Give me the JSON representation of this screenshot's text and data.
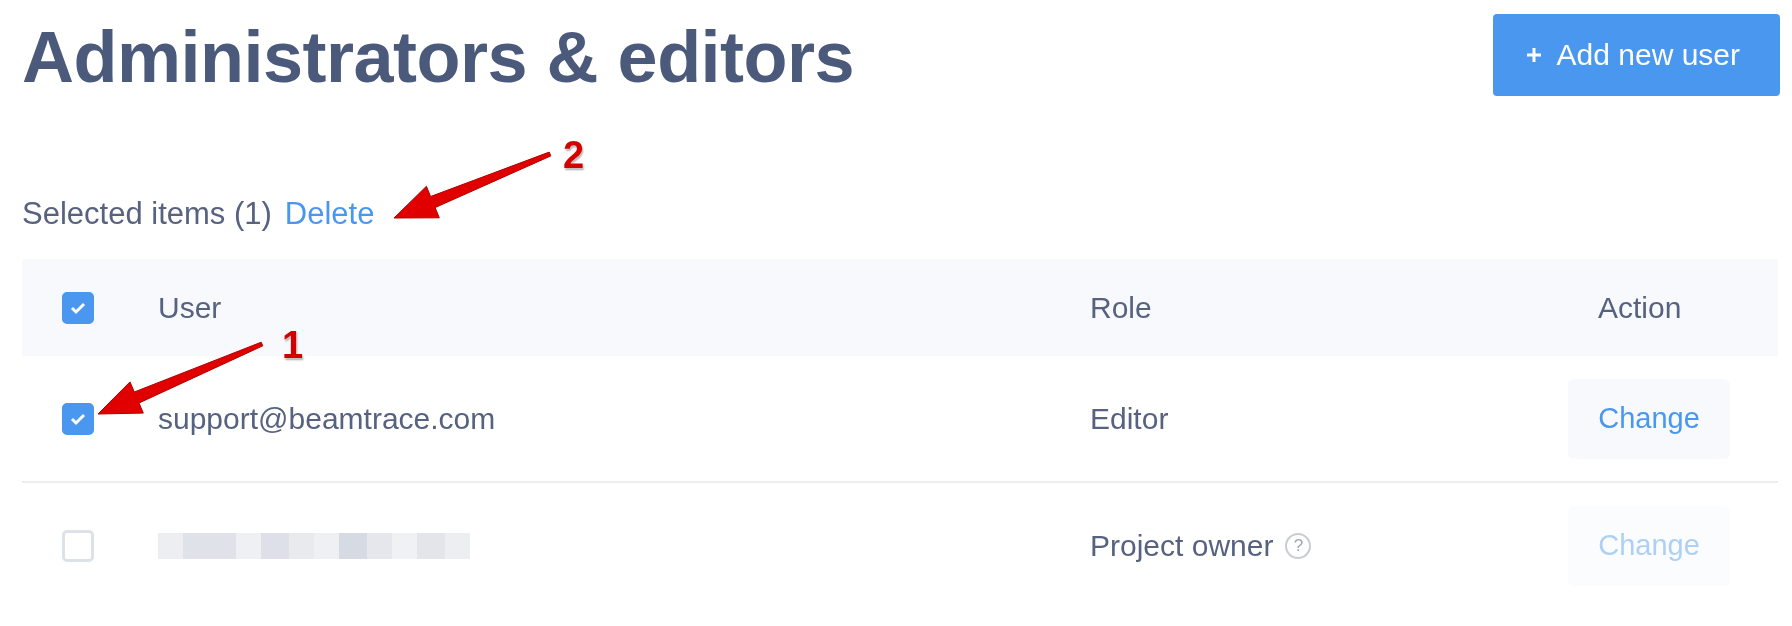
{
  "title": "Administrators & editors",
  "add_button": {
    "label": "Add new user"
  },
  "selection": {
    "label": "Selected items (1)",
    "action": "Delete"
  },
  "table": {
    "all_selected": true,
    "columns": [
      "User",
      "Role",
      "Action"
    ],
    "rows": [
      {
        "selected": true,
        "redacted": false,
        "user": "support@beamtrace.com",
        "role": "Editor",
        "help": false,
        "action": "Change",
        "disabled": false
      },
      {
        "selected": false,
        "redacted": true,
        "role": "Project owner",
        "help": "?",
        "action": "Change",
        "disabled": true
      }
    ]
  },
  "annotations": [
    {
      "number": "1"
    },
    {
      "number": "2"
    }
  ]
}
